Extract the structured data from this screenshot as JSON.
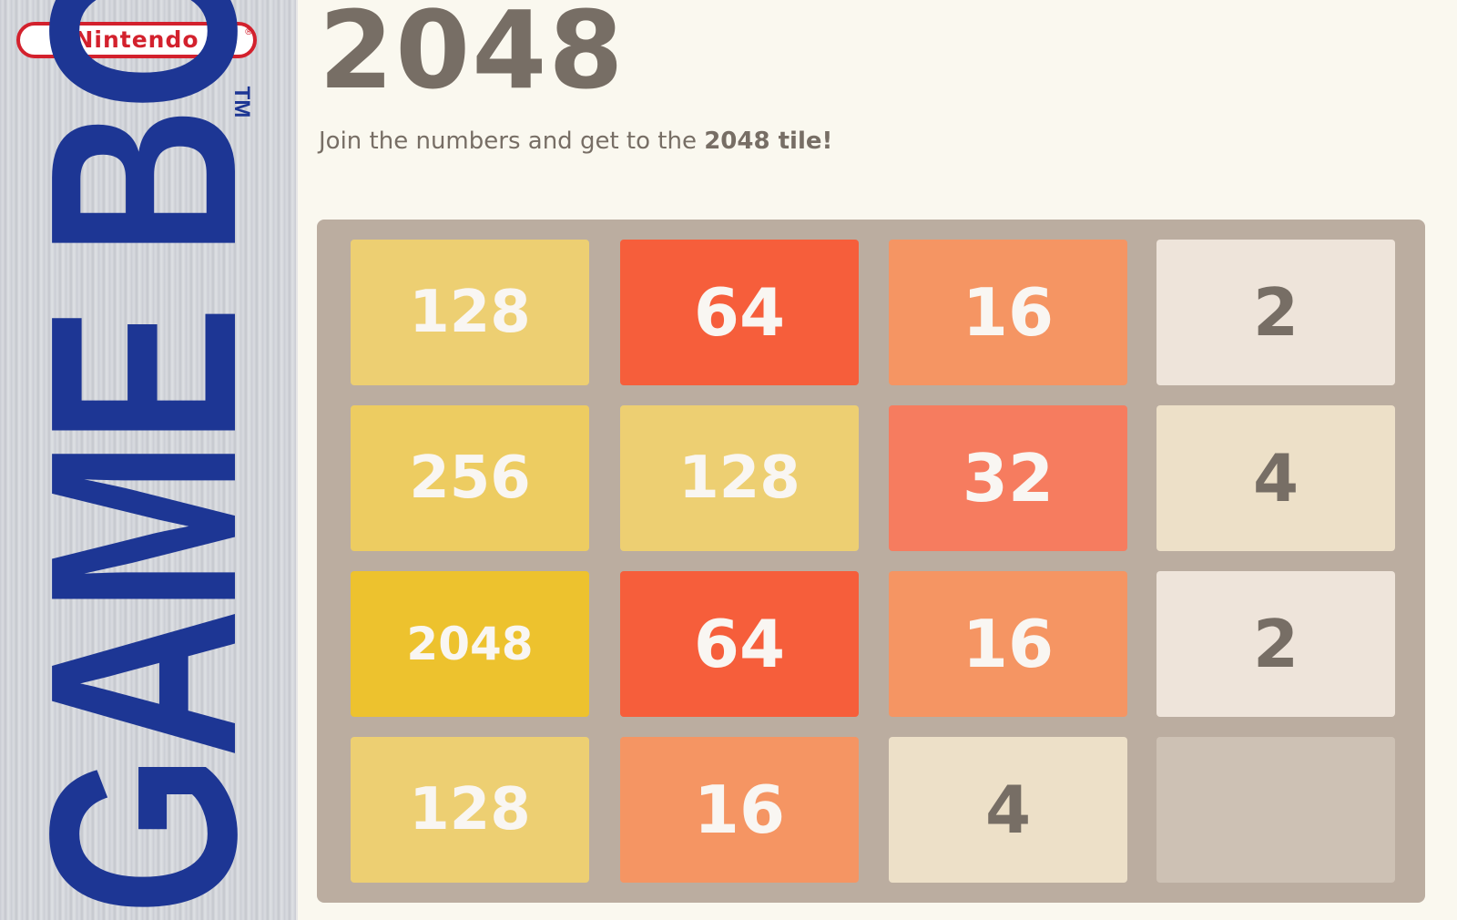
{
  "side_strip": {
    "brand": "Nintendo",
    "brand_mark": "®",
    "product": "GAME BOY",
    "trademark": "TM"
  },
  "header": {
    "title": "2048",
    "intro_prefix": "Join the numbers and get to the ",
    "intro_bold": "2048 tile!"
  },
  "board": {
    "tiles": [
      [
        "128",
        "64",
        "16",
        "2"
      ],
      [
        "256",
        "128",
        "32",
        "4"
      ],
      [
        "2048",
        "64",
        "16",
        "2"
      ],
      [
        "128",
        "16",
        "4",
        ""
      ]
    ]
  },
  "colors": {
    "title_text": "#776e65",
    "board_bg": "#bbada0",
    "empty_cell": "#cdc1b4",
    "brand_red": "#d3212d",
    "gameboy_blue": "#1d3694",
    "tile_2": "#eee4da",
    "tile_4": "#ede0c8",
    "tile_16": "#f59563",
    "tile_32": "#f67c5f",
    "tile_64": "#f65e3b",
    "tile_128": "#edcf72",
    "tile_256": "#edcc61",
    "tile_2048": "#edc22e"
  }
}
